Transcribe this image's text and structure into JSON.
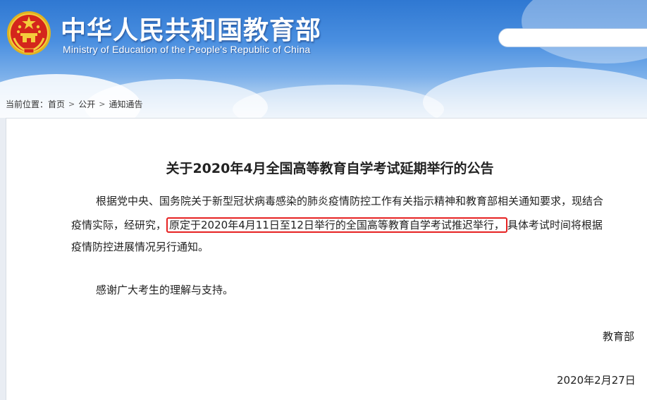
{
  "header": {
    "title": "中华人民共和国教育部",
    "subtitle": "Ministry of Education of the People's Republic of China",
    "emblem_icon": "national-emblem-icon",
    "search_placeholder": ""
  },
  "breadcrumb": {
    "prefix": "当前位置：",
    "items": [
      "首页",
      "公开",
      "通知通告"
    ],
    "separator": ">"
  },
  "article": {
    "title": "关于2020年4月全国高等教育自学考试延期举行的公告",
    "body": {
      "line1": "根据党中央、国务院关于新型冠状病毒感染的肺炎疫情防控工作有关指示精神和教育部相关通知要求，现结合",
      "line2_before": "疫情实际，经研究，",
      "line2_highlight": "原定于2020年4月11日至12日举行的全国高等教育自学考试推迟举行，",
      "line2_after": "具体考试时间将根据",
      "line3": "疫情防控进展情况另行通知。"
    },
    "thanks": "感谢广大考生的理解与支持。",
    "signature": "教育部",
    "date": "2020年2月27日"
  },
  "colors": {
    "highlight_border": "#e62222",
    "header_blue": "#2f78d2",
    "emblem_red": "#d4261c",
    "emblem_gold": "#f2c230"
  }
}
